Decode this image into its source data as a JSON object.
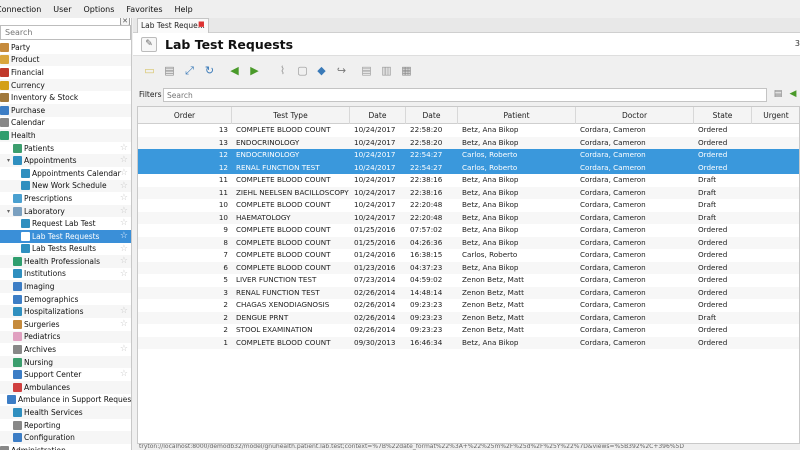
{
  "menu": [
    "Connection",
    "User",
    "Options",
    "Favorites",
    "Help"
  ],
  "sidebar": {
    "search_placeholder": "Search",
    "items": [
      {
        "label": "Party",
        "indent": 0,
        "icon": "party-icon",
        "color": "#c58a3c",
        "star": false
      },
      {
        "label": "Product",
        "indent": 0,
        "icon": "product-icon",
        "color": "#d9a53c",
        "star": false
      },
      {
        "label": "Financial",
        "indent": 0,
        "icon": "financial-icon",
        "color": "#c0392b",
        "star": false
      },
      {
        "label": "Currency",
        "indent": 0,
        "icon": "currency-icon",
        "color": "#d4a017",
        "star": false
      },
      {
        "label": "Inventory & Stock",
        "indent": 0,
        "icon": "inventory-icon",
        "color": "#a0783c",
        "star": false
      },
      {
        "label": "Purchase",
        "indent": 0,
        "icon": "purchase-icon",
        "color": "#3c7dc5",
        "star": false
      },
      {
        "label": "Calendar",
        "indent": 0,
        "icon": "calendar-icon",
        "color": "#888888",
        "star": false
      },
      {
        "label": "Health",
        "indent": 0,
        "icon": "health-icon",
        "color": "#2f9e6e",
        "star": false
      },
      {
        "label": "Patients",
        "indent": 1,
        "icon": "patients-icon",
        "color": "#3c9e6e",
        "star": true
      },
      {
        "label": "Appointments",
        "indent": 1,
        "icon": "appointments-icon",
        "color": "#2f8fbf",
        "star": true,
        "arrow": true
      },
      {
        "label": "Appointments Calendar",
        "indent": 2,
        "icon": "appointments-calendar-icon",
        "color": "#2f8fbf",
        "star": true
      },
      {
        "label": "New Work Schedule",
        "indent": 2,
        "icon": "work-schedule-icon",
        "color": "#2f8fbf",
        "star": true
      },
      {
        "label": "Prescriptions",
        "indent": 1,
        "icon": "prescriptions-icon",
        "color": "#4aa0d0",
        "star": true
      },
      {
        "label": "Laboratory",
        "indent": 1,
        "icon": "laboratory-icon",
        "color": "#7aa0c0",
        "star": true,
        "arrow": true
      },
      {
        "label": "Request Lab Test",
        "indent": 2,
        "icon": "request-lab-test-icon",
        "color": "#2f8fbf",
        "star": true
      },
      {
        "label": "Lab Test Requests",
        "indent": 2,
        "icon": "lab-test-requests-icon",
        "color": "#ffffff",
        "star": true,
        "selected": true
      },
      {
        "label": "Lab Tests Results",
        "indent": 2,
        "icon": "lab-tests-results-icon",
        "color": "#2f8fbf",
        "star": true
      },
      {
        "label": "Health Professionals",
        "indent": 1,
        "icon": "health-professionals-icon",
        "color": "#2f9e6e",
        "star": true
      },
      {
        "label": "Institutions",
        "indent": 1,
        "icon": "institutions-icon",
        "color": "#2f8fbf",
        "star": true
      },
      {
        "label": "Imaging",
        "indent": 1,
        "icon": "imaging-icon",
        "color": "#3c7dc5",
        "star": false
      },
      {
        "label": "Demographics",
        "indent": 1,
        "icon": "demographics-icon",
        "color": "#3c7dc5",
        "star": false
      },
      {
        "label": "Hospitalizations",
        "indent": 1,
        "icon": "hospitalizations-icon",
        "color": "#2f8fbf",
        "star": true
      },
      {
        "label": "Surgeries",
        "indent": 1,
        "icon": "surgeries-icon",
        "color": "#c58a3c",
        "star": true
      },
      {
        "label": "Pediatrics",
        "indent": 1,
        "icon": "pediatrics-icon",
        "color": "#e0a0c0",
        "star": false
      },
      {
        "label": "Archives",
        "indent": 1,
        "icon": "archives-icon",
        "color": "#888888",
        "star": true
      },
      {
        "label": "Nursing",
        "indent": 1,
        "icon": "nursing-icon",
        "color": "#3c9e6e",
        "star": false
      },
      {
        "label": "Support Center",
        "indent": 1,
        "icon": "support-center-icon",
        "color": "#3c7dc5",
        "star": true
      },
      {
        "label": "Ambulances",
        "indent": 1,
        "icon": "ambulances-icon",
        "color": "#d04040",
        "star": false
      },
      {
        "label": "Ambulance in Support Reques",
        "indent": 1,
        "icon": "ambulance-support-icon",
        "color": "#3c7dc5",
        "star": true
      },
      {
        "label": "Health Services",
        "indent": 1,
        "icon": "health-services-icon",
        "color": "#2f8fbf",
        "star": false
      },
      {
        "label": "Reporting",
        "indent": 1,
        "icon": "reporting-icon",
        "color": "#888888",
        "star": false
      },
      {
        "label": "Configuration",
        "indent": 1,
        "icon": "configuration-icon",
        "color": "#3c7dc5",
        "star": false
      },
      {
        "label": "Administration",
        "indent": 0,
        "icon": "administration-icon",
        "color": "#888888",
        "star": false
      }
    ]
  },
  "tab": {
    "label": "Lab Test Reque..."
  },
  "header": {
    "title": "Lab Test Requests",
    "right_text": "3"
  },
  "filters": {
    "label": "Filters",
    "placeholder": "Search"
  },
  "table": {
    "columns": [
      "Order",
      "Test Type",
      "Date",
      "Date",
      "Patient",
      "Doctor",
      "State",
      "Urgent"
    ],
    "rows": [
      {
        "order": "13",
        "test": "COMPLETE BLOOD COUNT",
        "date": "10/24/2017",
        "time": "22:58:20",
        "patient": "Betz, Ana Bikop",
        "doctor": "Cordara, Cameron",
        "state": "Ordered",
        "sel": false
      },
      {
        "order": "13",
        "test": "ENDOCRINOLOGY",
        "date": "10/24/2017",
        "time": "22:58:20",
        "patient": "Betz, Ana Bikop",
        "doctor": "Cordara, Cameron",
        "state": "Ordered",
        "sel": false
      },
      {
        "order": "12",
        "test": "ENDOCRINOLOGY",
        "date": "10/24/2017",
        "time": "22:54:27",
        "patient": "Carlos, Roberto",
        "doctor": "Cordara, Cameron",
        "state": "Ordered",
        "sel": true
      },
      {
        "order": "12",
        "test": "RENAL FUNCTION TEST",
        "date": "10/24/2017",
        "time": "22:54:27",
        "patient": "Carlos, Roberto",
        "doctor": "Cordara, Cameron",
        "state": "Ordered",
        "sel": true
      },
      {
        "order": "11",
        "test": "COMPLETE BLOOD COUNT",
        "date": "10/24/2017",
        "time": "22:38:16",
        "patient": "Betz, Ana Bikop",
        "doctor": "Cordara, Cameron",
        "state": "Draft",
        "sel": false
      },
      {
        "order": "11",
        "test": "ZIEHL NEELSEN BACILLOSCOPY",
        "date": "10/24/2017",
        "time": "22:38:16",
        "patient": "Betz, Ana Bikop",
        "doctor": "Cordara, Cameron",
        "state": "Draft",
        "sel": false
      },
      {
        "order": "10",
        "test": "COMPLETE BLOOD COUNT",
        "date": "10/24/2017",
        "time": "22:20:48",
        "patient": "Betz, Ana Bikop",
        "doctor": "Cordara, Cameron",
        "state": "Draft",
        "sel": false
      },
      {
        "order": "10",
        "test": "HAEMATOLOGY",
        "date": "10/24/2017",
        "time": "22:20:48",
        "patient": "Betz, Ana Bikop",
        "doctor": "Cordara, Cameron",
        "state": "Draft",
        "sel": false
      },
      {
        "order": "9",
        "test": "COMPLETE BLOOD COUNT",
        "date": "01/25/2016",
        "time": "07:57:02",
        "patient": "Betz, Ana Bikop",
        "doctor": "Cordara, Cameron",
        "state": "Ordered",
        "sel": false
      },
      {
        "order": "8",
        "test": "COMPLETE BLOOD COUNT",
        "date": "01/25/2016",
        "time": "04:26:36",
        "patient": "Betz, Ana Bikop",
        "doctor": "Cordara, Cameron",
        "state": "Ordered",
        "sel": false
      },
      {
        "order": "7",
        "test": "COMPLETE BLOOD COUNT",
        "date": "01/24/2016",
        "time": "16:38:15",
        "patient": "Carlos, Roberto",
        "doctor": "Cordara, Cameron",
        "state": "Ordered",
        "sel": false
      },
      {
        "order": "6",
        "test": "COMPLETE BLOOD COUNT",
        "date": "01/23/2016",
        "time": "04:37:23",
        "patient": "Betz, Ana Bikop",
        "doctor": "Cordara, Cameron",
        "state": "Ordered",
        "sel": false
      },
      {
        "order": "5",
        "test": "LIVER FUNCTION TEST",
        "date": "07/23/2014",
        "time": "04:59:02",
        "patient": "Zenon Betz, Matt",
        "doctor": "Cordara, Cameron",
        "state": "Ordered",
        "sel": false
      },
      {
        "order": "3",
        "test": "RENAL FUNCTION TEST",
        "date": "02/26/2014",
        "time": "14:48:14",
        "patient": "Zenon Betz, Matt",
        "doctor": "Cordara, Cameron",
        "state": "Ordered",
        "sel": false
      },
      {
        "order": "2",
        "test": "CHAGAS XENODIAGNOSIS",
        "date": "02/26/2014",
        "time": "09:23:23",
        "patient": "Zenon Betz, Matt",
        "doctor": "Cordara, Cameron",
        "state": "Ordered",
        "sel": false
      },
      {
        "order": "2",
        "test": "DENGUE PRNT",
        "date": "02/26/2014",
        "time": "09:23:23",
        "patient": "Zenon Betz, Matt",
        "doctor": "Cordara, Cameron",
        "state": "Draft",
        "sel": false
      },
      {
        "order": "2",
        "test": "STOOL EXAMINATION",
        "date": "02/26/2014",
        "time": "09:23:23",
        "patient": "Zenon Betz, Matt",
        "doctor": "Cordara, Cameron",
        "state": "Ordered",
        "sel": false
      },
      {
        "order": "1",
        "test": "COMPLETE BLOOD COUNT",
        "date": "09/30/2013",
        "time": "16:46:34",
        "patient": "Betz, Ana Bikop",
        "doctor": "Cordara, Cameron",
        "state": "Ordered",
        "sel": false
      }
    ]
  },
  "status": {
    "url": "tryton://localhost:8000/demodb32/model/gnuhealth.patient.lab.test;context=%7B%22date_format%22%3A+%22%25m%2F%25d%2F%25Y%22%7D&views=%5B392%2C+396%5D"
  },
  "colors": {
    "accent": "#3a98dc",
    "sidebar_selected": "#3a8fd8"
  }
}
